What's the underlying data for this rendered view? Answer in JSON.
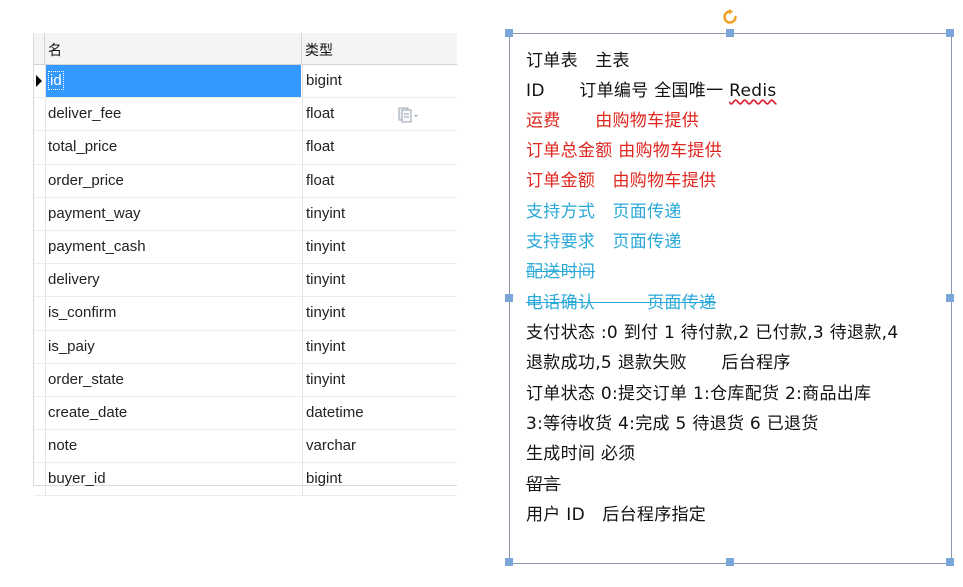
{
  "grid": {
    "header": {
      "name": "名",
      "type": "类型"
    },
    "rows": [
      {
        "name": "id",
        "type": "bigint"
      },
      {
        "name": "deliver_fee",
        "type": "float"
      },
      {
        "name": "total_price",
        "type": "float"
      },
      {
        "name": "order_price",
        "type": "float"
      },
      {
        "name": "payment_way",
        "type": "tinyint"
      },
      {
        "name": "payment_cash",
        "type": "tinyint"
      },
      {
        "name": "delivery",
        "type": "tinyint"
      },
      {
        "name": "is_confirm",
        "type": "tinyint"
      },
      {
        "name": "is_paiy",
        "type": "tinyint"
      },
      {
        "name": "order_state",
        "type": "tinyint"
      },
      {
        "name": "create_date",
        "type": "datetime"
      },
      {
        "name": "note",
        "type": "varchar"
      },
      {
        "name": "buyer_id",
        "type": "bigint"
      }
    ]
  },
  "notes": {
    "l1": "订单表　主表",
    "l2a": "ID　　订单编号  全国唯一  ",
    "l2b": "Redis",
    "l3": "运费　　由购物车提供",
    "l4": "订单总金额  由购物车提供",
    "l5": "订单金额　由购物车提供",
    "l6": "支持方式　页面传递",
    "l7": "支持要求　页面传递",
    "l8": "配送时间",
    "l9a": "电话确认",
    "l9b": "　　　",
    "l9c": "页面传递",
    "l10": "支付状态  :0 到付 1 待付款,2 已付款,3 待退款,4",
    "l11": "退款成功,5 退款失败　　后台程序",
    "l12": "订单状态  0:提交订单  1:仓库配货  2:商品出库",
    "l13": "3:等待收货  4:完成  5 待退货  6 已退货",
    "l14": "生成时间  必须",
    "l15": "留言",
    "l16": "用户 ID　后台程序指定"
  },
  "colors": {
    "red": "#e0261e",
    "cyan": "#2aa8d8",
    "selection": "#3399ff"
  },
  "icons": {
    "row_marker": "row-pointer-icon",
    "copy": "copy-icon",
    "rotate": "rotate-handle-icon"
  }
}
